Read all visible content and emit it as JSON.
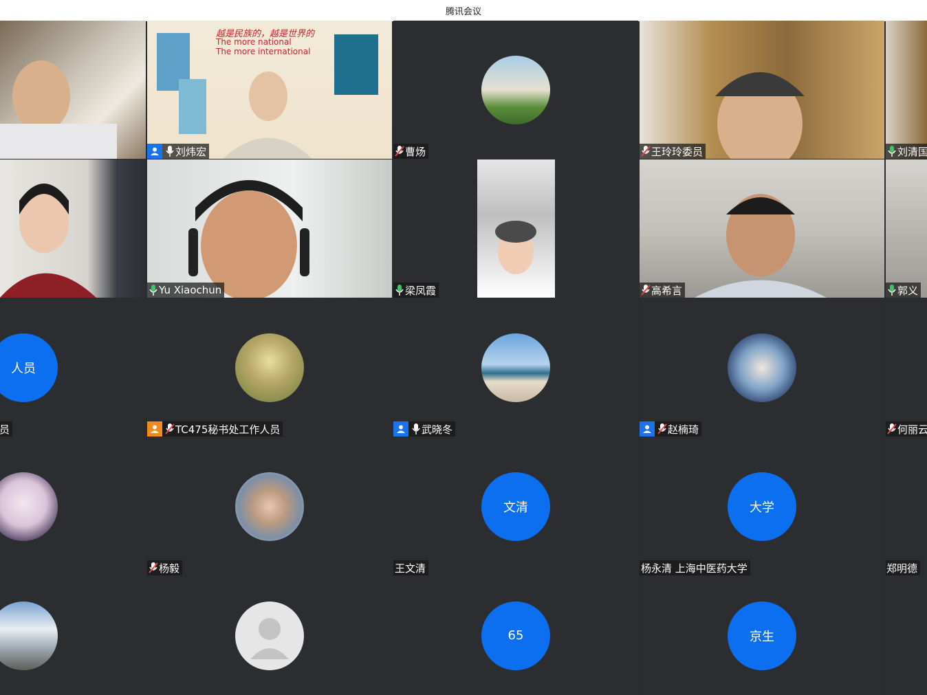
{
  "window": {
    "title": "腾讯会议"
  },
  "participants": [
    {
      "name": ""
    },
    {
      "name": "刘炜宏"
    },
    {
      "name": "曹炀"
    },
    {
      "name": "王玲玲委员"
    },
    {
      "name": "刘清国"
    },
    {
      "name": ""
    },
    {
      "name": "Yu Xiaochun"
    },
    {
      "name": "梁凤霞"
    },
    {
      "name": "高希言"
    },
    {
      "name": "郭义"
    },
    {
      "name": "人员",
      "avatar_text": "人员"
    },
    {
      "name": "TC475秘书处工作人员"
    },
    {
      "name": "武晓冬"
    },
    {
      "name": "赵楠琦"
    },
    {
      "name": "何丽云"
    },
    {
      "name": ""
    },
    {
      "name": "杨毅"
    },
    {
      "name": "王文清",
      "avatar_text": "文清"
    },
    {
      "name": "杨永清 上海中医药大学",
      "avatar_text": "大学"
    },
    {
      "name": "郑明德"
    },
    {
      "name": ""
    },
    {
      "name": ""
    },
    {
      "name": "",
      "avatar_text": "65"
    },
    {
      "name": "",
      "avatar_text": "京生"
    }
  ],
  "slide": {
    "headline_cn": "越是民族的，越是世界的",
    "line1": "The more national",
    "line2": "The more international"
  },
  "colors": {
    "avatar_blue": "#0b6ff0",
    "tile_bg": "#2b2d31",
    "mic_green": "#3ec46d",
    "mic_muted": "#e04848"
  }
}
